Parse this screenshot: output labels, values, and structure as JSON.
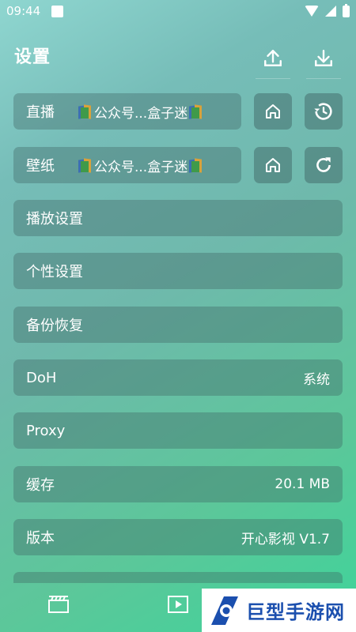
{
  "status_bar": {
    "time": "09:44"
  },
  "header": {
    "title": "设置",
    "upload_icon": "upload-icon",
    "download_icon": "download-icon"
  },
  "rows": {
    "live": {
      "label": "直播",
      "source": "公众号...盒子迷"
    },
    "wallpaper": {
      "label": "壁纸",
      "source": "公众号...盒子迷"
    },
    "playback": {
      "label": "播放设置"
    },
    "personal": {
      "label": "个性设置"
    },
    "backup": {
      "label": "备份恢复"
    },
    "doh": {
      "label": "DoH",
      "value": "系统"
    },
    "proxy": {
      "label": "Proxy"
    },
    "cache": {
      "label": "缓存",
      "value": "20.1 MB"
    },
    "version": {
      "label": "版本",
      "value": "开心影视 V1.7"
    }
  },
  "watermark": {
    "text": "巨型手游网"
  },
  "colors": {
    "accent": "#3ed49a",
    "logo_blue": "#1b4fae"
  }
}
